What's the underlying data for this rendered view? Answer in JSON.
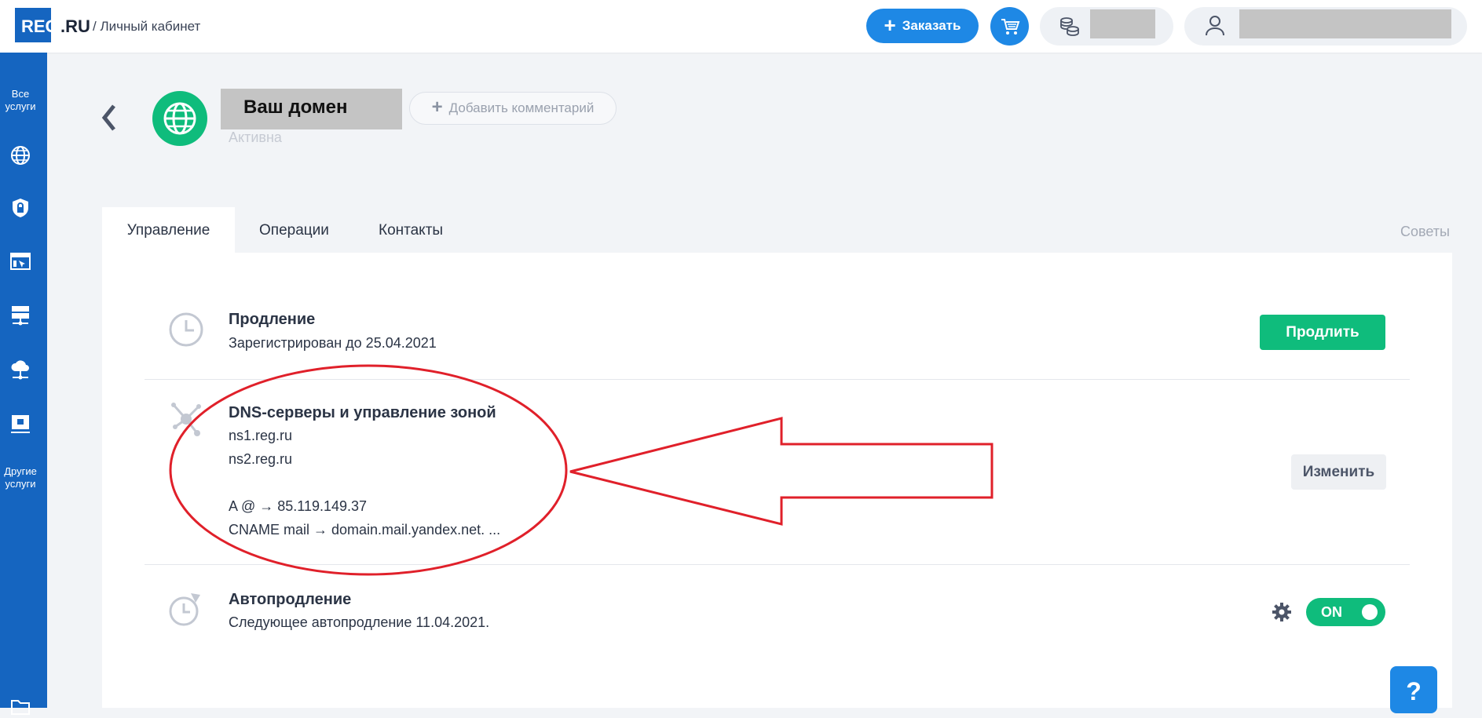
{
  "header": {
    "logo_text": "REG",
    "logo_suffix": ".RU",
    "breadcrumb": "/ Личный кабинет",
    "order_button": "Заказать",
    "cart_icon": "cart-icon",
    "balance_icon": "coins-icon",
    "user_icon": "user-icon"
  },
  "sidebar": {
    "all_services": "Все услуги",
    "icons": [
      "globe-icon",
      "shield-lock-icon",
      "website-builder-icon",
      "server-icon",
      "cloud-server-icon",
      "hosting-icon"
    ],
    "other_services": "Другие услуги",
    "bottom_icon": "folder-icon"
  },
  "domain": {
    "name": "Ваш домен",
    "status": "Активна",
    "add_comment": "Добавить комментарий"
  },
  "tabs": [
    "Управление",
    "Операции",
    "Контакты"
  ],
  "tips_link": "Советы",
  "rows": {
    "renewal": {
      "title": "Продление",
      "text": "Зарегистрирован до 25.04.2021",
      "button": "Продлить"
    },
    "dns": {
      "title": "DNS-серверы и управление зоной",
      "ns": [
        "ns1.reg.ru",
        "ns2.reg.ru"
      ],
      "records": [
        "A @ → 85.119.149.37",
        "CNAME mail → domain.mail.yandex.net. ..."
      ],
      "button": "Изменить"
    },
    "autorenew": {
      "title": "Автопродление",
      "text": "Следующее автопродление 11.04.2021.",
      "toggle": "ON"
    }
  },
  "help_label": "?",
  "colors": {
    "brand_blue": "#1565c0",
    "accent_blue": "#1e88e5",
    "green": "#0fbc7c",
    "annotation_red": "#e0202a"
  }
}
